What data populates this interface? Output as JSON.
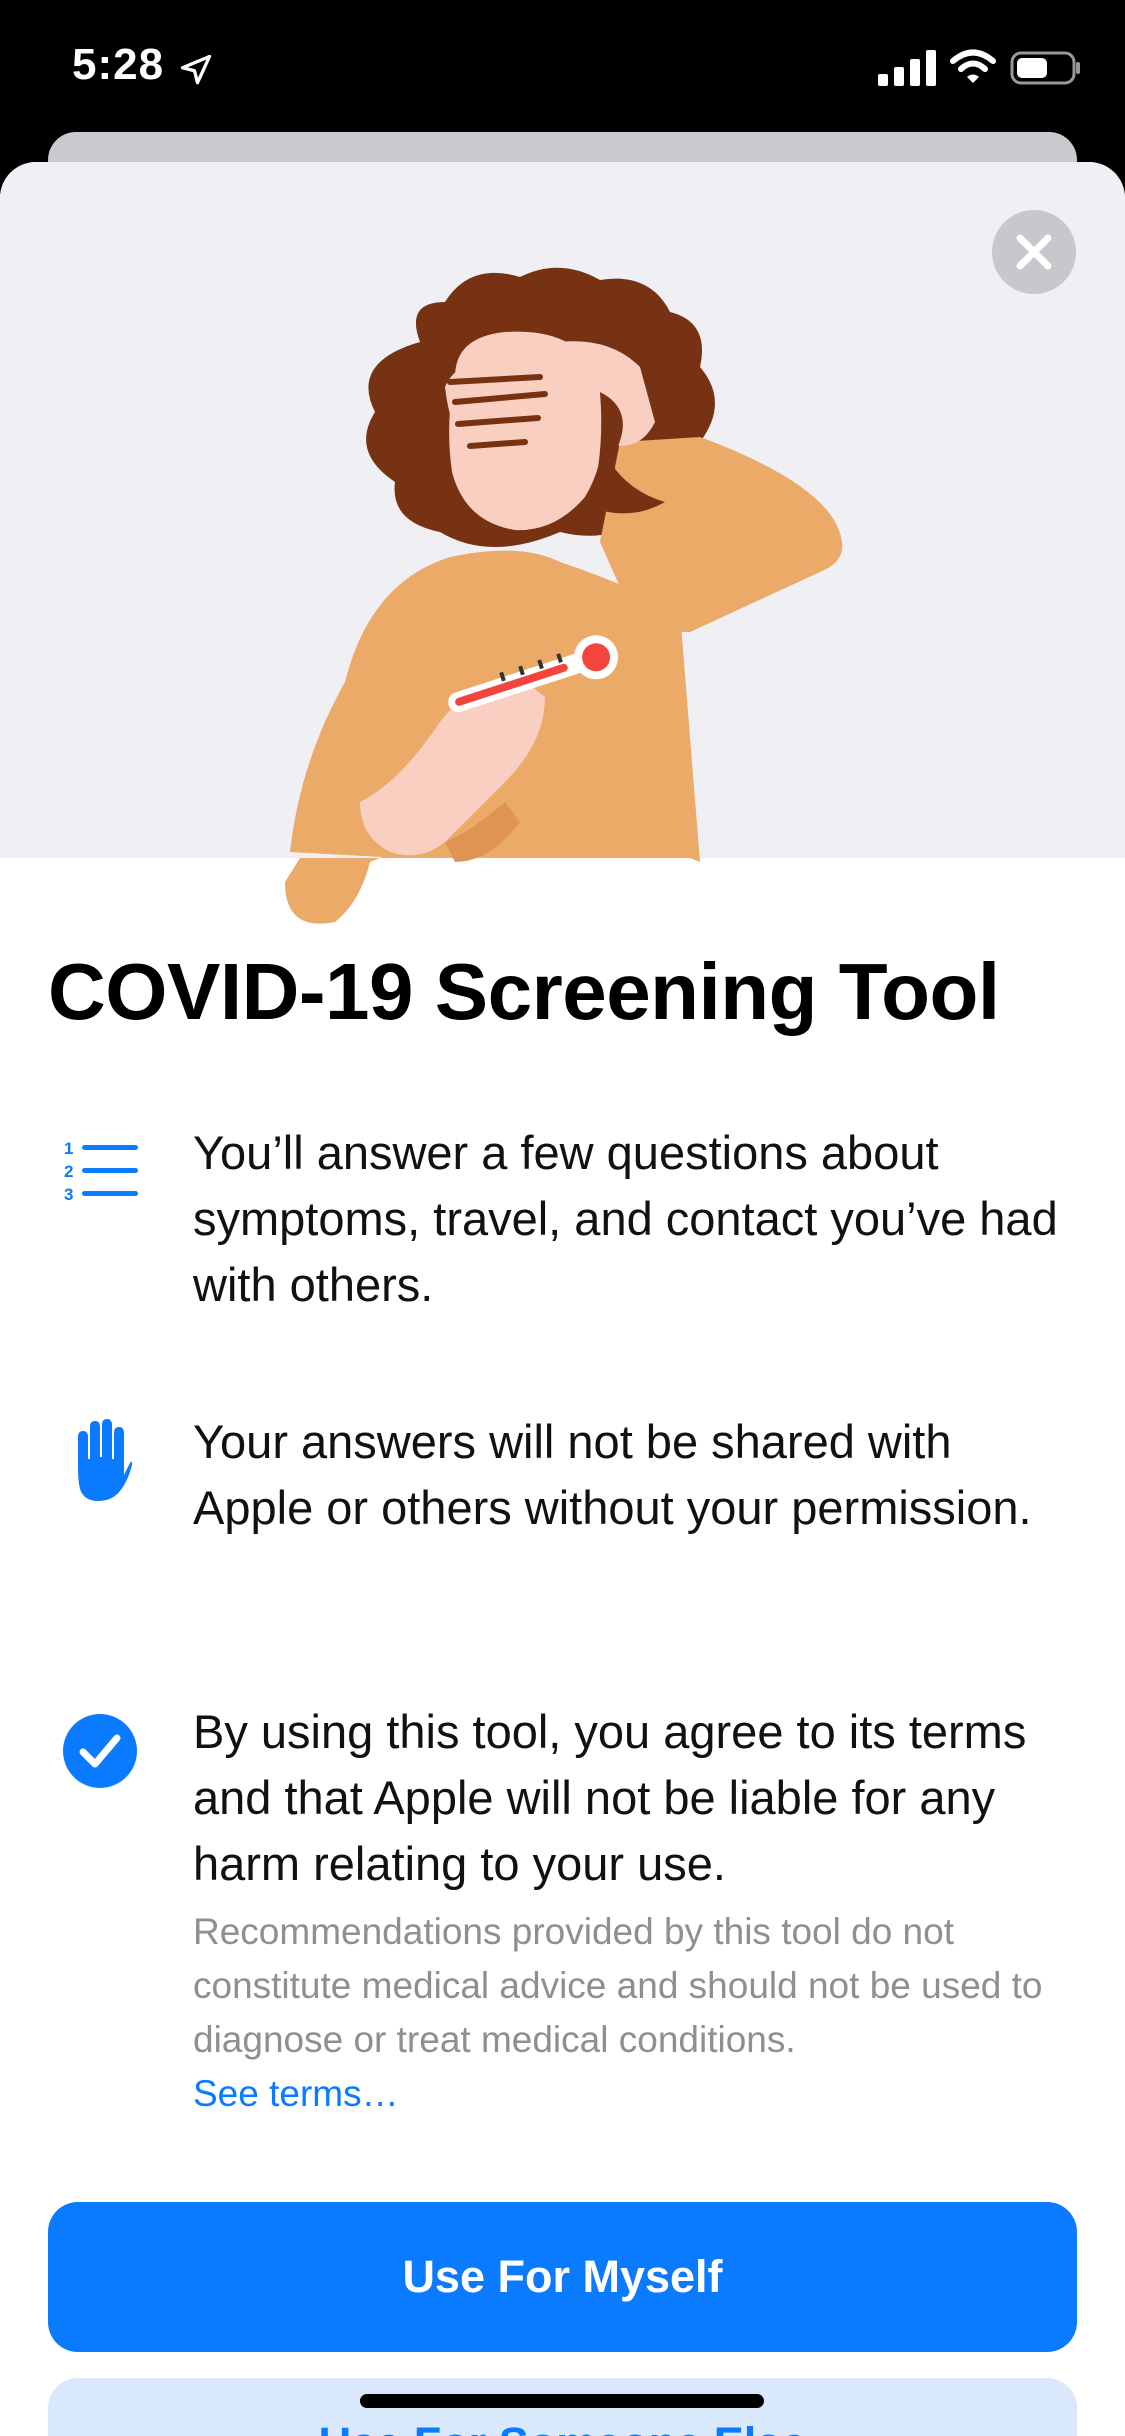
{
  "status_bar": {
    "time": "5:28",
    "icons": [
      "location-arrow-icon",
      "cellular-signal-icon",
      "wifi-icon",
      "battery-icon"
    ]
  },
  "sheet": {
    "close_icon": "close-icon",
    "title": "COVID-19 Screening Tool",
    "items": [
      {
        "icon": "numbered-list-icon",
        "text": "You’ll answer a few questions about symptoms, travel, and contact you’ve had with others."
      },
      {
        "icon": "raised-hand-icon",
        "text": "Your answers will not be shared with Apple or others without your permission."
      },
      {
        "icon": "checkmark-circle-icon",
        "text": "By using this tool, you agree to its terms and that Apple will not be liable for any harm relating to your use.",
        "note": "Recommendations provided by this tool do not constitute medical advice and should not be used to diagnose or treat medical conditions.",
        "link": "See terms…"
      }
    ],
    "primary_button": "Use For Myself",
    "secondary_button": "Use For Someone Else"
  },
  "colors": {
    "accent": "#0A7AFF",
    "hero_bg": "#EFEFF4",
    "skin": "#F9CFC2",
    "sweater": "#EBAA68",
    "hair": "#773214",
    "thermometer": "#F2453D"
  }
}
